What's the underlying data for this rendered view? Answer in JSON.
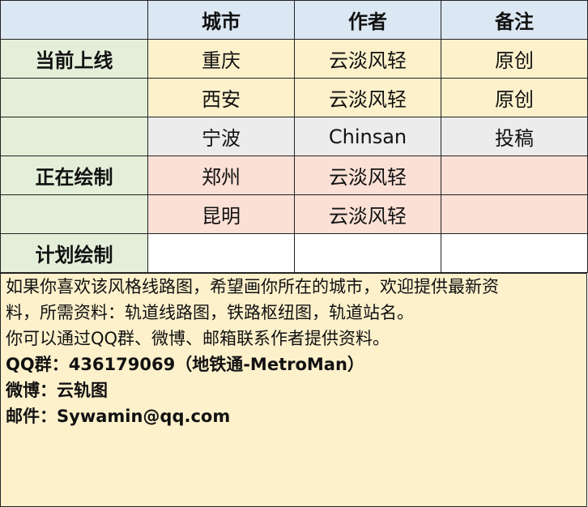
{
  "table": {
    "headers": [
      "",
      "城市",
      "作者",
      "备注"
    ],
    "groups": {
      "online": "当前上线",
      "drawing": "正在绘制",
      "planned": "计划绘制"
    },
    "rows": [
      {
        "city": "重庆",
        "author": "云淡风轻",
        "note": "原创"
      },
      {
        "city": "西安",
        "author": "云淡风轻",
        "note": "原创"
      },
      {
        "city": "宁波",
        "author": "Chinsan",
        "note": "投稿"
      },
      {
        "city": "郑州",
        "author": "云淡风轻",
        "note": ""
      },
      {
        "city": "昆明",
        "author": "云淡风轻",
        "note": ""
      },
      {
        "city": "",
        "author": "",
        "note": ""
      }
    ]
  },
  "notes": {
    "line1": "如果你喜欢该风格线路图，希望画你所在的城市，欢迎提供最新资",
    "line2": "料，所需资料：轨道线路图，铁路枢纽图，轨道站名。",
    "line3": "你可以通过QQ群、微博、邮箱联系作者提供资料。",
    "qq": "QQ群：436179069（地铁通-MetroMan）",
    "weibo": "微博：云轨图",
    "email": "邮件：Sywamin@qq.com"
  },
  "colors": {
    "header": "#dbe7f3",
    "group_label": "#e4efd9",
    "online_row": "#fdf1cc",
    "submission_row": "#ececec",
    "drawing_row": "#fbe0d6",
    "notes_bg": "#fdf1cc"
  }
}
